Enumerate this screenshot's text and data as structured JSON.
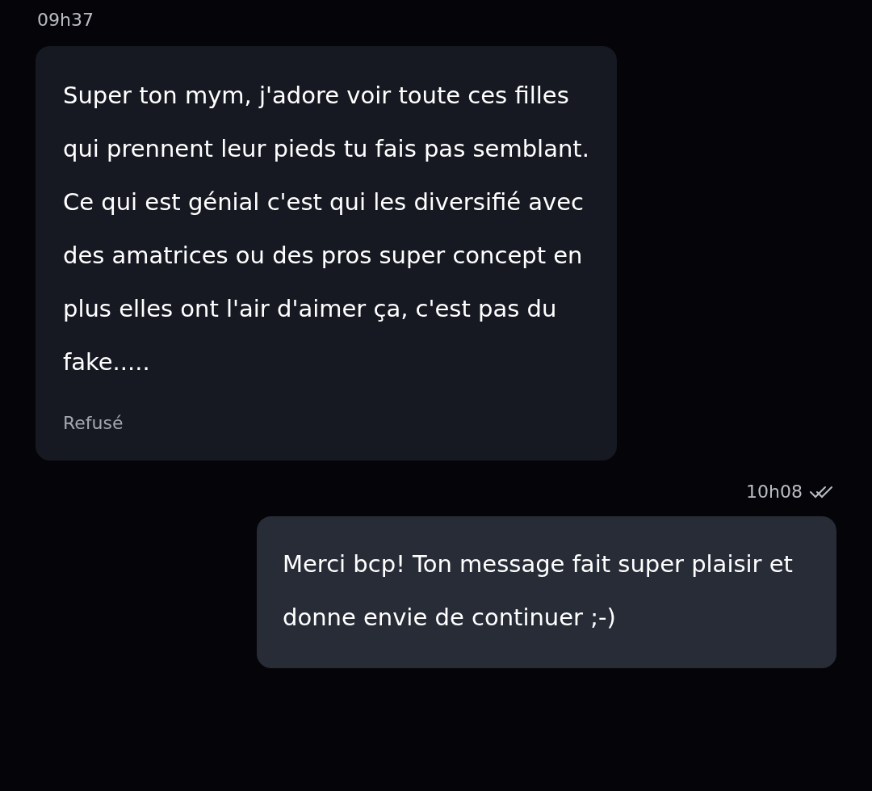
{
  "messages": [
    {
      "kind": "incoming",
      "time": "09h37",
      "text": "Super ton mym, j'adore voir toute ces filles qui prennent leur pieds tu fais pas semblant.\nCe qui est génial c'est qui les diversifié avec des amatrices ou des pros super concept en plus elles ont l'air d'aimer ça, c'est pas du fake.....",
      "status": "Refusé"
    },
    {
      "kind": "outgoing",
      "time": "10h08",
      "text": "Merci bcp! Ton message fait super plaisir et donne envie de continuer ;-)"
    }
  ]
}
